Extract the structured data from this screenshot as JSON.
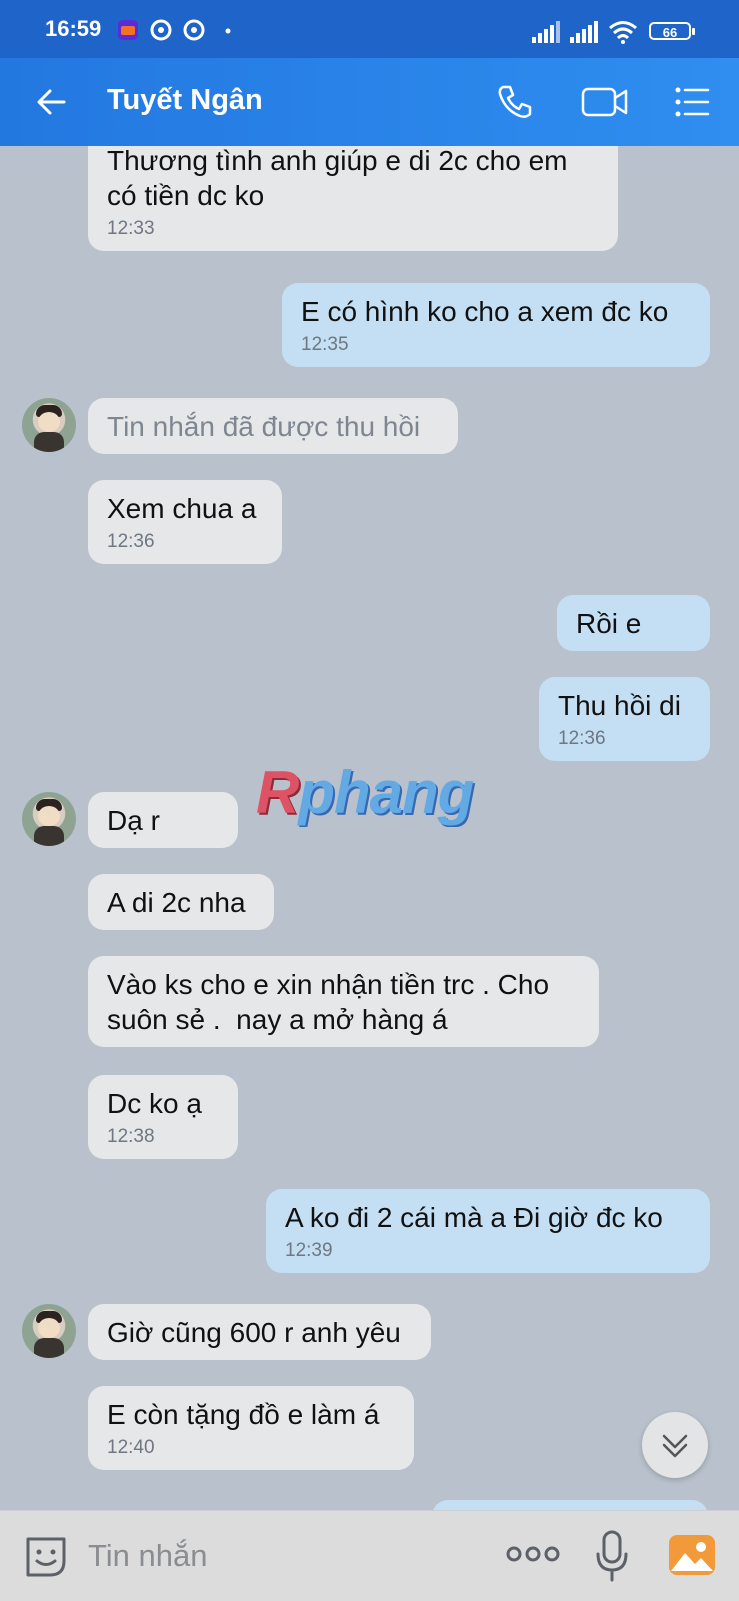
{
  "status_bar": {
    "time": "16:59",
    "battery": "66"
  },
  "header": {
    "contact_name": "Tuyết Ngân"
  },
  "messages": [
    {
      "dir": "in",
      "text": "Thương tình anh giúp e di 2c cho em\ncó tiền dc ko",
      "time": "12:33"
    },
    {
      "dir": "out",
      "text": "E có hình ko cho a xem đc ko",
      "time": "12:35"
    },
    {
      "dir": "in",
      "text": "Tin nhắn đã được thu hồi",
      "time": "",
      "recalled": true
    },
    {
      "dir": "in",
      "text": "Xem chua a",
      "time": "12:36"
    },
    {
      "dir": "out",
      "text": "Rồi e",
      "time": ""
    },
    {
      "dir": "out",
      "text": "Thu hồi di",
      "time": "12:36"
    },
    {
      "dir": "in",
      "text": "Dạ r",
      "time": ""
    },
    {
      "dir": "in",
      "text": "A di 2c nha",
      "time": ""
    },
    {
      "dir": "in",
      "text": "Vào ks cho e xin nhận tiền trc . Cho\nsuôn sẻ .  nay a mở hàng á",
      "time": ""
    },
    {
      "dir": "in",
      "text": "Dc ko ạ",
      "time": "12:38"
    },
    {
      "dir": "out",
      "text": "A ko đi 2 cái mà a Đi giờ đc ko",
      "time": "12:39"
    },
    {
      "dir": "in",
      "text": "Giờ cũng 600 r anh yêu",
      "time": ""
    },
    {
      "dir": "in",
      "text": "E còn tặng đồ e làm á",
      "time": "12:40"
    }
  ],
  "watermark": {
    "first": "R",
    "rest": "phang"
  },
  "input": {
    "placeholder": "Tin nhắn"
  },
  "colors": {
    "header": "#2378e0",
    "chat_bg": "#b9c2cc",
    "incoming": "#e6e7e9",
    "outgoing": "#c4dff3"
  }
}
